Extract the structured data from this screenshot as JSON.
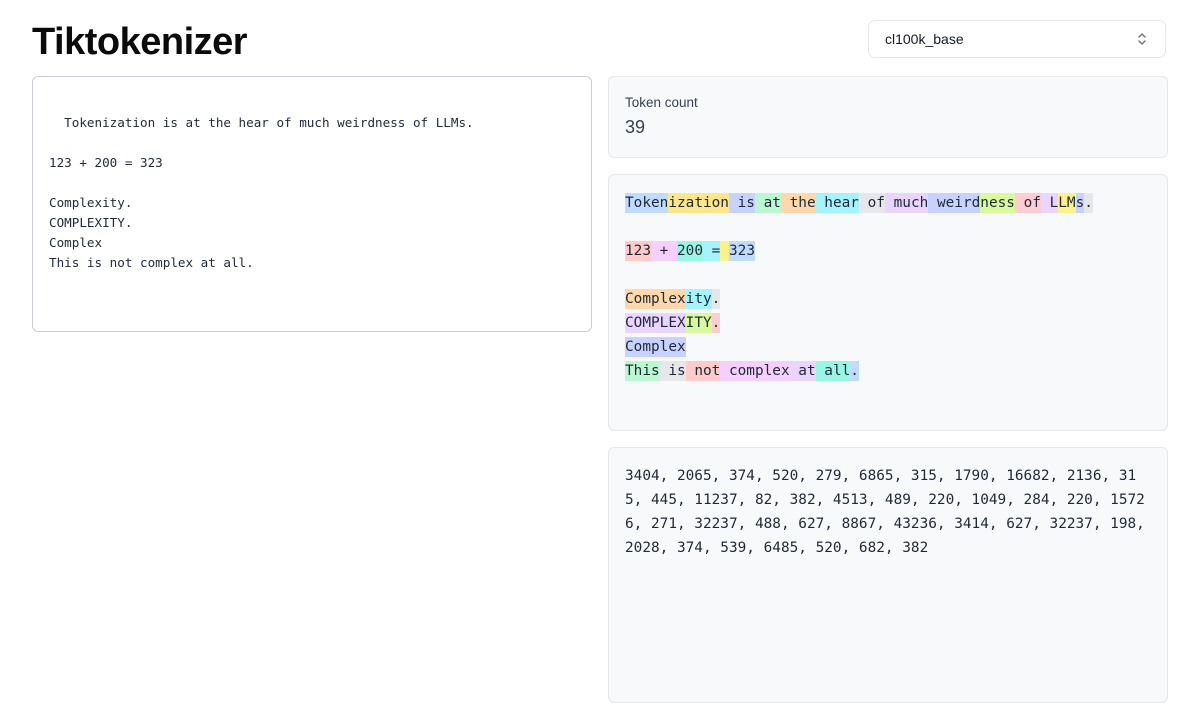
{
  "app": {
    "title": "Tiktokenizer"
  },
  "encoding": {
    "selected": "cl100k_base"
  },
  "input": {
    "text": "Tokenization is at the hear of much weirdness of LLMs.\n\n123 + 200 = 323\n\nComplexity.\nCOMPLEXITY.\nComplex\nThis is not complex at all."
  },
  "stats": {
    "token_count_label": "Token count",
    "token_count": "39"
  },
  "palette": [
    "#bfdbfe",
    "#fde68a",
    "#a5f3fc",
    "#bbf7d0",
    "#fed7aa",
    "#e9d5ff",
    "#c7d2fe",
    "#d9f99d",
    "#fecdd3",
    "#f5d0fe",
    "#99f6e4",
    "#e5e7eb",
    "#fef08a",
    "#fecaca"
  ],
  "tokens": [
    {
      "t": "Token",
      "c": 0
    },
    {
      "t": "ization",
      "c": 1
    },
    {
      "t": " is",
      "c": 6
    },
    {
      "t": " at",
      "c": 3
    },
    {
      "t": " the",
      "c": 4
    },
    {
      "t": " hear",
      "c": 2
    },
    {
      "t": " of",
      "c": 11
    },
    {
      "t": " much",
      "c": 5
    },
    {
      "t": " weird",
      "c": 6
    },
    {
      "t": "ness",
      "c": 7
    },
    {
      "t": " of",
      "c": 8
    },
    {
      "t": " L",
      "c": 5
    },
    {
      "t": "LM",
      "c": 12
    },
    {
      "t": "s",
      "c": 6
    },
    {
      "t": ".",
      "c": 11
    },
    {
      "t": "\n\n",
      "c": 13
    },
    {
      "t": "123",
      "c": 13
    },
    {
      "t": " +",
      "c": 9
    },
    {
      "t": " ",
      "c": 9
    },
    {
      "t": "200",
      "c": 10
    },
    {
      "t": " =",
      "c": 2
    },
    {
      "t": " ",
      "c": 12
    },
    {
      "t": "323",
      "c": 0
    },
    {
      "t": "\n\n",
      "c": 11
    },
    {
      "t": "Complex",
      "c": 4
    },
    {
      "t": "ity",
      "c": 2
    },
    {
      "t": ".",
      "c": 11
    },
    {
      "t": "\n",
      "c": 11
    },
    {
      "t": "COMPLEX",
      "c": 5
    },
    {
      "t": "ITY",
      "c": 7
    },
    {
      "t": ".",
      "c": 8
    },
    {
      "t": "\n",
      "c": 8
    },
    {
      "t": "Complex",
      "c": 6
    },
    {
      "t": "\n",
      "c": 6
    },
    {
      "t": "This",
      "c": 3
    },
    {
      "t": " is",
      "c": 11
    },
    {
      "t": " not",
      "c": 13
    },
    {
      "t": " complex",
      "c": 9
    },
    {
      "t": " at",
      "c": 5
    },
    {
      "t": " all",
      "c": 10
    },
    {
      "t": ".",
      "c": 0
    }
  ],
  "token_ids": "3404, 2065, 374, 520, 279, 6865, 315, 1790, 16682, 2136, 315, 445, 11237, 82, 382, 4513, 489, 220, 1049, 284, 220, 15726, 271, 32237, 488, 627, 8867, 43236, 3414, 627, 32237, 198, 2028, 374, 539, 6485, 520, 682, 382",
  "icons": {
    "select": "chevron-up-down-icon",
    "resize": "resize-grip-icon"
  }
}
